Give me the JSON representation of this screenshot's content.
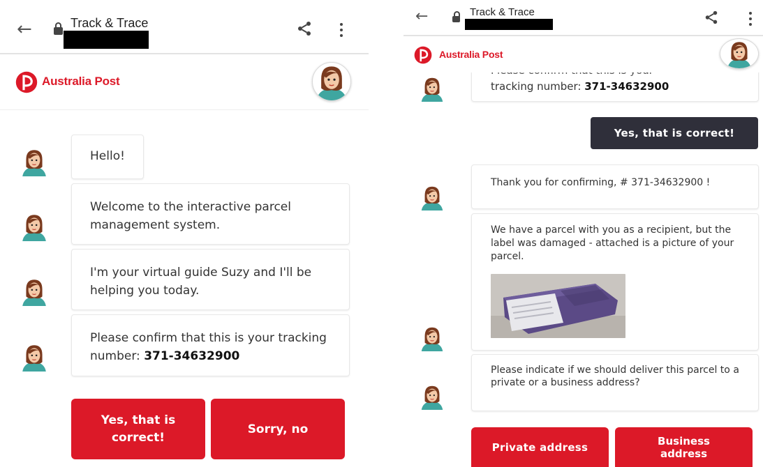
{
  "left": {
    "appbar": {
      "title": "Track & Trace"
    },
    "brand": {
      "name": "Australia Post"
    },
    "messages": [
      {
        "text": "Hello!"
      },
      {
        "text": "Welcome to the interactive parcel management system."
      },
      {
        "text": "I'm your virtual guide Suzy and I'll be helping you today."
      },
      {
        "prefix": "Please confirm that this is your tracking number: ",
        "tracking": "371-34632900"
      }
    ],
    "buttons": {
      "yes": "Yes, that is correct!",
      "no": "Sorry, no"
    }
  },
  "right": {
    "appbar": {
      "title": "Track & Trace"
    },
    "brand": {
      "name": "Australia Post"
    },
    "cut_message": {
      "partial": "Please confirm that this is your",
      "prefix": "tracking number: ",
      "tracking": "371-34632900"
    },
    "user_reply": "Yes, that is correct!",
    "messages": [
      {
        "text": "Thank you for confirming, # 371-34632900 !"
      },
      {
        "text": "We have a parcel with you as a recipient, but the label was damaged - attached is a picture of your parcel."
      },
      {
        "text": "Please indicate if we should deliver this parcel to a private or a business address?"
      }
    ],
    "buttons": {
      "private": "Private address",
      "business": "Business address"
    }
  },
  "colors": {
    "brand_red": "#dc1928",
    "user_bubble": "#2f2f3a",
    "avatar_teal": "#3fa6a0",
    "avatar_hair": "#7a3a1e"
  },
  "icons": {
    "back": "arrow-left-icon",
    "lock": "lock-icon",
    "share": "share-icon",
    "more": "more-vert-icon"
  }
}
